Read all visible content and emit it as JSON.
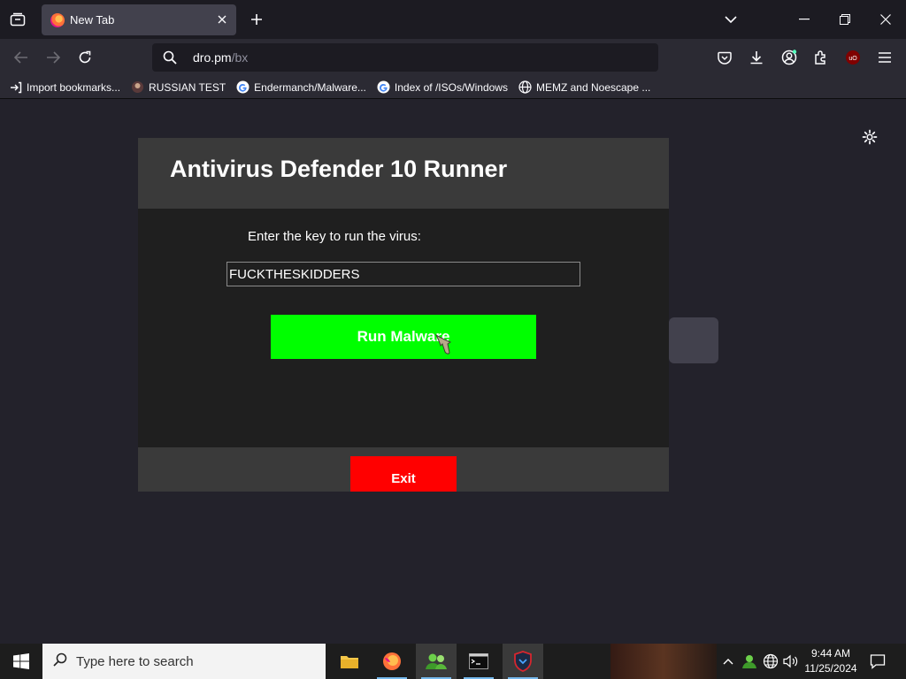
{
  "browser": {
    "tab": {
      "title": "New Tab",
      "favicon": "firefox-icon"
    },
    "url": {
      "host": "dro.pm",
      "path": "/bx"
    },
    "bookmarks": [
      {
        "label": "Import bookmarks...",
        "icon": "import-icon"
      },
      {
        "label": "RUSSIAN TEST",
        "icon": "site-icon"
      },
      {
        "label": "Endermanch/Malware...",
        "icon": "google-icon"
      },
      {
        "label": "Index of /ISOs/Windows",
        "icon": "google-icon"
      },
      {
        "label": "MEMZ and Noescape ...",
        "icon": "globe-icon"
      }
    ]
  },
  "app": {
    "title": "Antivirus Defender 10 Runner",
    "prompt": "Enter the key to run the virus:",
    "key_value": "FUCKTHESKIDDERS",
    "run_label": "Run Malware",
    "exit_label": "Exit",
    "colors": {
      "run": "#00ff00",
      "exit": "#ff0000",
      "header": "#3a3a3a",
      "body": "#1f1f1f"
    }
  },
  "taskbar": {
    "search_placeholder": "Type here to search",
    "time": "9:44 AM",
    "date": "11/25/2024",
    "apps": [
      "file-explorer-icon",
      "firefox-icon",
      "users-icon",
      "terminal-icon",
      "shield-app-icon"
    ]
  }
}
